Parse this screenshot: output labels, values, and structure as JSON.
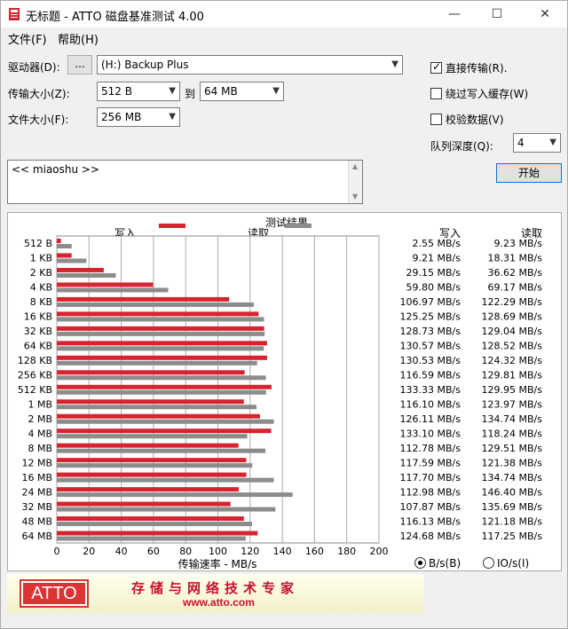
{
  "window": {
    "title": "无标题 - ATTO 磁盘基准测试 4.00",
    "minimize_glyph": "—",
    "maximize_glyph": "☐",
    "close_glyph": "✕"
  },
  "menu": {
    "file": "文件(F)",
    "help": "帮助(H)"
  },
  "form": {
    "drive_label": "驱动器(D):",
    "browse_button": "...",
    "drive_value": "(H:) Backup Plus",
    "transfer_label": "传输大小(Z):",
    "transfer_from": "512 B",
    "to_label": "到",
    "transfer_to": "64 MB",
    "file_size_label": "文件大小(F):",
    "file_size_value": "256 MB",
    "direct_io_label": "直接传输(R).",
    "direct_io_checked": true,
    "bypass_cache_label": "绕过写入缓存(W)",
    "bypass_cache_checked": false,
    "verify_label": "校验数据(V)",
    "verify_checked": false,
    "queue_label": "队列深度(Q):",
    "queue_value": "4",
    "start_button": "开始",
    "description": "<< miaoshu >>"
  },
  "results": {
    "panel_title": "测试结果",
    "write_legend": "写入",
    "read_legend": "读取",
    "write_col": "写入",
    "read_col": "读取",
    "xlabel": "传输速率 - MB/s",
    "write_color": "#d7232f",
    "read_color": "#8c8c8c",
    "rows": [
      {
        "size": "512 B",
        "write_text": "2.55 MB/s",
        "read_text": "9.23 MB/s"
      },
      {
        "size": "1 KB",
        "write_text": "9.21 MB/s",
        "read_text": "18.31 MB/s"
      },
      {
        "size": "2 KB",
        "write_text": "29.15 MB/s",
        "read_text": "36.62 MB/s"
      },
      {
        "size": "4 KB",
        "write_text": "59.80 MB/s",
        "read_text": "69.17 MB/s"
      },
      {
        "size": "8 KB",
        "write_text": "106.97 MB/s",
        "read_text": "122.29 MB/s"
      },
      {
        "size": "16 KB",
        "write_text": "125.25 MB/s",
        "read_text": "128.69 MB/s"
      },
      {
        "size": "32 KB",
        "write_text": "128.73 MB/s",
        "read_text": "129.04 MB/s"
      },
      {
        "size": "64 KB",
        "write_text": "130.57 MB/s",
        "read_text": "128.52 MB/s"
      },
      {
        "size": "128 KB",
        "write_text": "130.53 MB/s",
        "read_text": "124.32 MB/s"
      },
      {
        "size": "256 KB",
        "write_text": "116.59 MB/s",
        "read_text": "129.81 MB/s"
      },
      {
        "size": "512 KB",
        "write_text": "133.33 MB/s",
        "read_text": "129.95 MB/s"
      },
      {
        "size": "1 MB",
        "write_text": "116.10 MB/s",
        "read_text": "123.97 MB/s"
      },
      {
        "size": "2 MB",
        "write_text": "126.11 MB/s",
        "read_text": "134.74 MB/s"
      },
      {
        "size": "4 MB",
        "write_text": "133.10 MB/s",
        "read_text": "118.24 MB/s"
      },
      {
        "size": "8 MB",
        "write_text": "112.78 MB/s",
        "read_text": "129.51 MB/s"
      },
      {
        "size": "12 MB",
        "write_text": "117.59 MB/s",
        "read_text": "121.38 MB/s"
      },
      {
        "size": "16 MB",
        "write_text": "117.70 MB/s",
        "read_text": "134.74 MB/s"
      },
      {
        "size": "24 MB",
        "write_text": "112.98 MB/s",
        "read_text": "146.40 MB/s"
      },
      {
        "size": "32 MB",
        "write_text": "107.87 MB/s",
        "read_text": "135.69 MB/s"
      },
      {
        "size": "48 MB",
        "write_text": "116.13 MB/s",
        "read_text": "121.18 MB/s"
      },
      {
        "size": "64 MB",
        "write_text": "124.68 MB/s",
        "read_text": "117.25 MB/s"
      }
    ],
    "unit_bs": "B/s(B)",
    "unit_bs_selected": true,
    "unit_ios": "IO/s(I)",
    "unit_ios_selected": false
  },
  "chart_data": {
    "type": "bar",
    "orientation": "horizontal",
    "categories": [
      "512 B",
      "1 KB",
      "2 KB",
      "4 KB",
      "8 KB",
      "16 KB",
      "32 KB",
      "64 KB",
      "128 KB",
      "256 KB",
      "512 KB",
      "1 MB",
      "2 MB",
      "4 MB",
      "8 MB",
      "12 MB",
      "16 MB",
      "24 MB",
      "32 MB",
      "48 MB",
      "64 MB"
    ],
    "series": [
      {
        "name": "写入",
        "values": [
          2.55,
          9.21,
          29.15,
          59.8,
          106.97,
          125.25,
          128.73,
          130.57,
          130.53,
          116.59,
          133.33,
          116.1,
          126.11,
          133.1,
          112.78,
          117.59,
          117.7,
          112.98,
          107.87,
          116.13,
          124.68
        ]
      },
      {
        "name": "读取",
        "values": [
          9.23,
          18.31,
          36.62,
          69.17,
          122.29,
          128.69,
          129.04,
          128.52,
          124.32,
          129.81,
          129.95,
          123.97,
          134.74,
          118.24,
          129.51,
          121.38,
          134.74,
          146.4,
          135.69,
          121.18,
          117.25
        ]
      }
    ],
    "xlabel": "传输速率 - MB/s",
    "xlim": [
      0,
      200
    ],
    "xticks": [
      "0",
      "20",
      "40",
      "60",
      "80",
      "100",
      "120",
      "140",
      "160",
      "180",
      "200"
    ],
    "grid": true,
    "legend": "top"
  },
  "footer": {
    "logo": "ATTO",
    "slogan": "存储与网络技术专家",
    "url": "www.atto.com"
  }
}
